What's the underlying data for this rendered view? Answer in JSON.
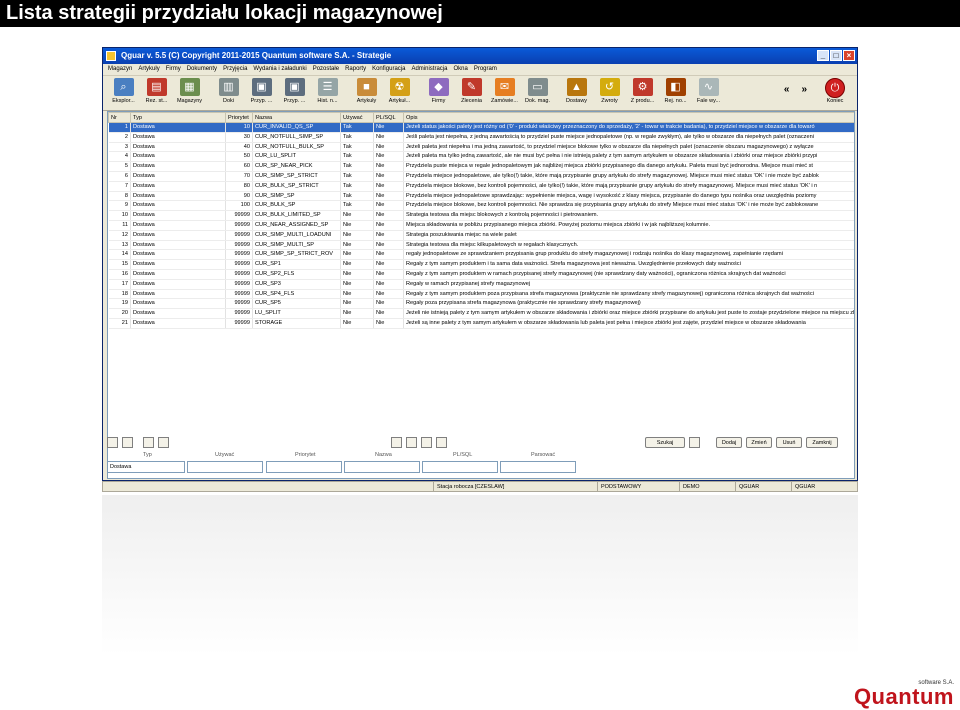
{
  "slide": {
    "title": "Lista strategii przydziału lokacji magazynowej"
  },
  "window": {
    "title": "Qguar v. 5.5   (C) Copyright 2011-2015 Quantum software S.A. - Strategie"
  },
  "menu": [
    "Magazyn",
    "Artykuły",
    "Firmy",
    "Dokumenty",
    "Przyjęcia",
    "Wydania i załadunki",
    "Pozostałe",
    "Raporty",
    "Konfiguracja",
    "Administracja",
    "Okna",
    "Program"
  ],
  "toolbar": [
    {
      "label": "Eksplor...",
      "icon": "explorer-icon",
      "color": "#4a7fc1",
      "glyph": "⌕"
    },
    {
      "label": "Rez. st...",
      "icon": "reservation-icon",
      "color": "#c0392b",
      "glyph": "▤"
    },
    {
      "label": "Magazyny",
      "icon": "warehouse-icon",
      "color": "#6b8e4e",
      "glyph": "▦"
    },
    {
      "label": "Doki",
      "icon": "dock-icon",
      "color": "#7f8c8d",
      "glyph": "▥"
    },
    {
      "label": "Przyp. ...",
      "icon": "assignment-icon",
      "color": "#5d6d7e",
      "glyph": "▣"
    },
    {
      "label": "Przyp. ...",
      "icon": "assignment2-icon",
      "color": "#5d6d7e",
      "glyph": "▣"
    },
    {
      "label": "Hist. n...",
      "icon": "history-icon",
      "color": "#95a5a6",
      "glyph": "☰"
    },
    {
      "label": "Artykuły",
      "icon": "box-icon",
      "color": "#c98c3a",
      "glyph": "■"
    },
    {
      "label": "Artykuł...",
      "icon": "hazard-icon",
      "color": "#d4a017",
      "glyph": "☢"
    },
    {
      "label": "Firmy",
      "icon": "company-icon",
      "color": "#8e6bbf",
      "glyph": "◆"
    },
    {
      "label": "Zlecenia",
      "icon": "order-icon",
      "color": "#c0392b",
      "glyph": "✎"
    },
    {
      "label": "Zamówie...",
      "icon": "purchase-icon",
      "color": "#e67e22",
      "glyph": "✉"
    },
    {
      "label": "Dok. mag.",
      "icon": "document-icon",
      "color": "#7f8c8d",
      "glyph": "▭"
    },
    {
      "label": "Dostawy",
      "icon": "delivery-icon",
      "color": "#b9770e",
      "glyph": "▲"
    },
    {
      "label": "Zwroty",
      "icon": "return-icon",
      "color": "#d4ac0d",
      "glyph": "↺"
    },
    {
      "label": "Z produ...",
      "icon": "production-icon",
      "color": "#c0392b",
      "glyph": "⚙"
    },
    {
      "label": "Rej. no...",
      "icon": "register-icon",
      "color": "#a04000",
      "glyph": "◧"
    },
    {
      "label": "Fale wy...",
      "icon": "wave-icon",
      "color": "#aab7b8",
      "glyph": "∿"
    }
  ],
  "nav": {
    "prev": "«",
    "next": "»",
    "exit": "Koniec"
  },
  "table": {
    "headers": [
      "Nr",
      "Typ",
      "Priorytet",
      "Nazwa",
      "Używać",
      "PL/SQL",
      "Opis"
    ],
    "rows": [
      [
        "1",
        "Dostawa",
        "10",
        "CUR_INVALID_QS_SP",
        "Tak",
        "Nie",
        "Jeżeli status jakości palety jest różny od ('0' - produkt właściwy przeznaczony do sprzedaży, '2' - towar w trakcie badania), to przydziel miejsce w obszarze dla towaró"
      ],
      [
        "2",
        "Dostawa",
        "30",
        "CUR_NOTFULL_SIMP_SP",
        "Tak",
        "Nie",
        "Jeśli paleta jest niepełna, z jedną zawartością to przydziel puste miejsce jednopaletowe (np. w regale zwykłym), ale tylko w obszarze dla niepełnych palet (oznaczeni"
      ],
      [
        "3",
        "Dostawa",
        "40",
        "CUR_NOTFULL_BULK_SP",
        "Tak",
        "Nie",
        "Jeżeli paleta jest niepełna i ma jedną zawartość, to przydziel miejsce blokowe tylko w obszarze dla niepełnych palet (oznaczenie obszaru magazynowego) z wyłącze"
      ],
      [
        "4",
        "Dostawa",
        "50",
        "CUR_LU_SPLIT",
        "Tak",
        "Nie",
        "Jeżeli paleta ma tylko jedną zawartość, ale nie musi być pełna i nie istnieją palety z tym samym artykułem w obszarze składowania i zbiórki oraz miejsce zbiórki przypi"
      ],
      [
        "5",
        "Dostawa",
        "60",
        "CUR_SP_NEAR_PICK",
        "Tak",
        "Nie",
        "Przydziela puste miejsca w regale jednopaletowym jak najbliżej miejsca zbiórki przypisanego dla danego artykułu. Paleta musi być jednorodna. Miejsce musi mieć st"
      ],
      [
        "6",
        "Dostawa",
        "70",
        "CUR_SIMP_SP_STRICT",
        "Tak",
        "Nie",
        "Przydziela miejsce jednopaletowe, ale tylko(!) takie, które mają przypisanie grupy artykułu do strefy magazynowej. Miejsce musi mieć status 'OK' i nie może być zablok"
      ],
      [
        "7",
        "Dostawa",
        "80",
        "CUR_BULK_SP_STRICT",
        "Tak",
        "Nie",
        "Przydziela miejsce blokowe, bez kontroli pojemności, ale tylko(!) takie, które mają przypisanie grupy artykułu do strefy magazynowej. Miejsce musi mieć status 'OK' i n"
      ],
      [
        "8",
        "Dostawa",
        "90",
        "CUR_SIMP_SP",
        "Tak",
        "Nie",
        "Przydziela miejsce jednopaletowe sprawdzając: wypełnienie miejsca, wagę i wysokość z klasy miejsca, przypisanie do danego typu nośnika oraz uwzględnia poziomy"
      ],
      [
        "9",
        "Dostawa",
        "100",
        "CUR_BULK_SP",
        "Tak",
        "Nie",
        "Przydziela miejsce blokowe, bez kontroli pojemności. Nie sprawdza się przypisania grupy artykułu do strefy Miejsce musi mieć status 'OK' i nie może być zablokowane"
      ],
      [
        "10",
        "Dostawa",
        "99999",
        "CUR_BULK_LIMITED_SP",
        "Nie",
        "Nie",
        "Strategia testowa dla miejsc blokowych z kontrolą pojemności i pietrowaniem."
      ],
      [
        "11",
        "Dostawa",
        "99999",
        "CUR_NEAR_ASSIGNED_SP",
        "Nie",
        "Nie",
        "Miejsca składowania w pobliżu przypisanego miejsca zbiórki. Powyżej poziomu miejsca zbiórki i w jak najbliższej kolumnie."
      ],
      [
        "12",
        "Dostawa",
        "99999",
        "CUR_SIMP_MULTI_LOADUNI",
        "Nie",
        "Nie",
        "Strategia poszukiwania miejsc na wiele palet"
      ],
      [
        "13",
        "Dostawa",
        "99999",
        "CUR_SIMP_MULTI_SP",
        "Nie",
        "Nie",
        "Strategia testowa dla miejsc kilkupaletowych w regałach klasycznych."
      ],
      [
        "14",
        "Dostawa",
        "99999",
        "CUR_SIMP_SP_STRICT_ROV",
        "Nie",
        "Nie",
        "regały jednopaletowe ze sprawdzaniem przypisania grup produktu do strefy magazynowej i rodzaju nośnika do klasy magazynowej, zapełnianie rzędami"
      ],
      [
        "15",
        "Dostawa",
        "99999",
        "CUR_SP1",
        "Nie",
        "Nie",
        "Regały z tym samym produktem i ta sama data ważności. Strefa magazynowa jest nieważna. Uwzględnienie przełowych daty ważności"
      ],
      [
        "16",
        "Dostawa",
        "99999",
        "CUR_SP2_FLS",
        "Nie",
        "Nie",
        "Regały z tym samym produktem w ramach przypisanej strefy magazynowej (nie sprawdzany daty ważności), ograniczona różnica skrajnych dat ważności"
      ],
      [
        "17",
        "Dostawa",
        "99999",
        "CUR_SP3",
        "Nie",
        "Nie",
        "Regały w ramach przypisanej strefy magazynowej"
      ],
      [
        "18",
        "Dostawa",
        "99999",
        "CUR_SP4_FLS",
        "Nie",
        "Nie",
        "Regały z tym samym produktem poza przypisana strefa magazynowa (praktycznie nie sprawdzany strefy magazynowej) ograniczona różnica skrajnych dat ważności"
      ],
      [
        "19",
        "Dostawa",
        "99999",
        "CUR_SP5",
        "Nie",
        "Nie",
        "Regały poza przypisana strefa magazynowa (praktycznie nie sprawdzany strefy magazynowej)"
      ],
      [
        "20",
        "Dostawa",
        "99999",
        "LU_SPLIT",
        "Nie",
        "Nie",
        "Jeżeli nie istnieją palety z tym samym artykułem w obszarze składowania i zbiórki oraz miejsce zbiórki przypisane do artykułu jest puste to zostaje przydzielone miejsce na miejscu zbiórki (palety pełne i"
      ],
      [
        "21",
        "Dostawa",
        "99999",
        "STORAGE",
        "Nie",
        "Nie",
        "Jeżeli są inne palety z tym samym artykułem w obszarze składowania lub paleta jest pełna i miejsce zbiórki jest zajęte, przydziel miejsce w obszarze składowania"
      ]
    ]
  },
  "actions": {
    "search": "Szukaj",
    "add": "Dodaj",
    "change": "Zmień",
    "delete": "Usuń",
    "close": "Zamknij"
  },
  "filters": {
    "labels": [
      "Typ",
      "Używać",
      "Priorytet",
      "Nazwa",
      "PL/SQL",
      "Parsować"
    ],
    "values": [
      "Dostawa",
      "",
      "",
      "",
      "",
      ""
    ]
  },
  "status": {
    "station": "Stacja robocza [CZESLAW]",
    "level": "PODSTAWOWY",
    "db": "DEMO",
    "user1": "QGUAR",
    "user2": "QGUAR"
  },
  "logo": {
    "sub": "software S.A.",
    "main": "Quantum"
  }
}
